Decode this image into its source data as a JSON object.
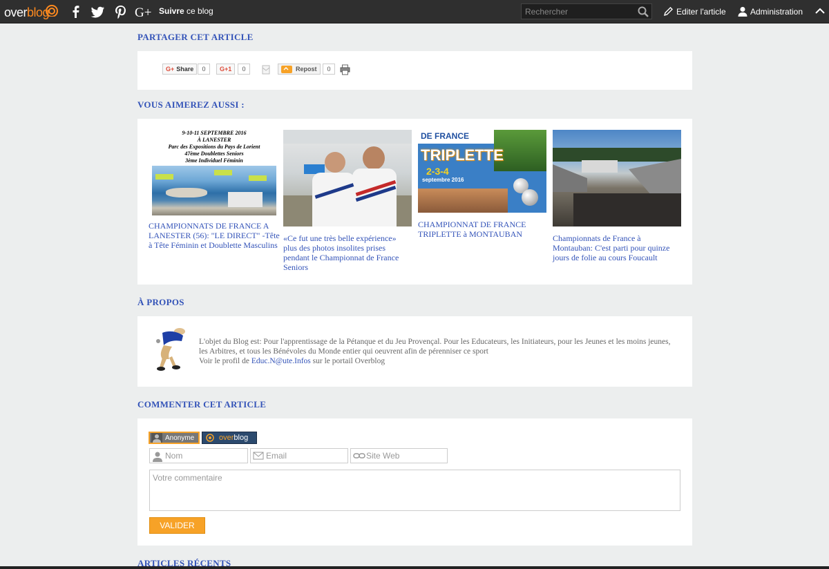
{
  "topbar": {
    "logo_prefix": "over",
    "logo_suffix": "blog",
    "follow_bold": "Suivre",
    "follow_rest": " ce blog",
    "search_placeholder": "Rechercher",
    "edit_label": "Editer l'article",
    "admin_label": "Administration",
    "social_icons": [
      "facebook-icon",
      "twitter-icon",
      "pinterest-icon",
      "google-plus-icon"
    ]
  },
  "share": {
    "title": "PARTAGER CET ARTICLE",
    "gshare_label": "Share",
    "gshare_count": "0",
    "gplus_label": "G+1",
    "gplus_count": "0",
    "repost_label": "Repost",
    "repost_count": "0"
  },
  "related": {
    "title": "VOUS AIMEREZ AUSSI :",
    "articles": [
      {
        "title": "CHAMPIONNATS DE FRANCE A LANESTER (56): \"LE DIRECT\" -Tête à Tête Féminin et Doublette Masculins",
        "thumb_text_1": "9-10-11 SEPTEMBRE 2016",
        "thumb_text_2": "À LANESTER",
        "thumb_text_3": "Parc des Expositions du Pays de Lorient",
        "thumb_text_4": "47ème Doublettes Seniors",
        "thumb_text_5": "3ème Individuel Féminin"
      },
      {
        "title": "«Ce fut une très belle expérience» plus des photos insolites prises pendant le Championnat de France Seniors"
      },
      {
        "title": "CHAMPIONNAT DE FRANCE TRIPLETTE à MONTAUBAN",
        "thumb_text_1": "DE FRANCE",
        "thumb_text_2": "TRIPLETTE",
        "thumb_text_3": "2-3-4",
        "thumb_text_4": "septembre 2016"
      },
      {
        "title": "Championnats de France à Montauban: C'est parti pour quinze jours de folie au cours Foucault"
      }
    ]
  },
  "about": {
    "title": "À PROPOS",
    "text": "L'objet du Blog est: Pour l'apprentissage de la Pétanque et du Jeu Provençal. Pour les Educateurs, les Initiateurs, pour les Jeunes et les moins jeunes, les Arbitres, et tous les Bénévoles du Monde entier qui oeuvrent afin de pérenniser ce sport",
    "profile_prefix": "Voir le profil de ",
    "profile_link": "Educ.N@ute.Infos",
    "profile_suffix": " sur le portail Overblog"
  },
  "comment": {
    "title": "COMMENTER CET ARTICLE",
    "tab_anon": "Anonyme",
    "tab_overblog_prefix": "over",
    "tab_overblog_suffix": "blog",
    "name_placeholder": "Nom",
    "email_placeholder": "Email",
    "website_placeholder": "Site Web",
    "comment_placeholder": "Votre commentaire",
    "submit_label": "VALIDER"
  },
  "recent": {
    "title": "ARTICLES RÉCENTS"
  },
  "colors": {
    "topbar": "#2f2f2f",
    "accent_orange": "#f7a227",
    "link_blue": "#3353b8",
    "background": "#eceeee"
  }
}
